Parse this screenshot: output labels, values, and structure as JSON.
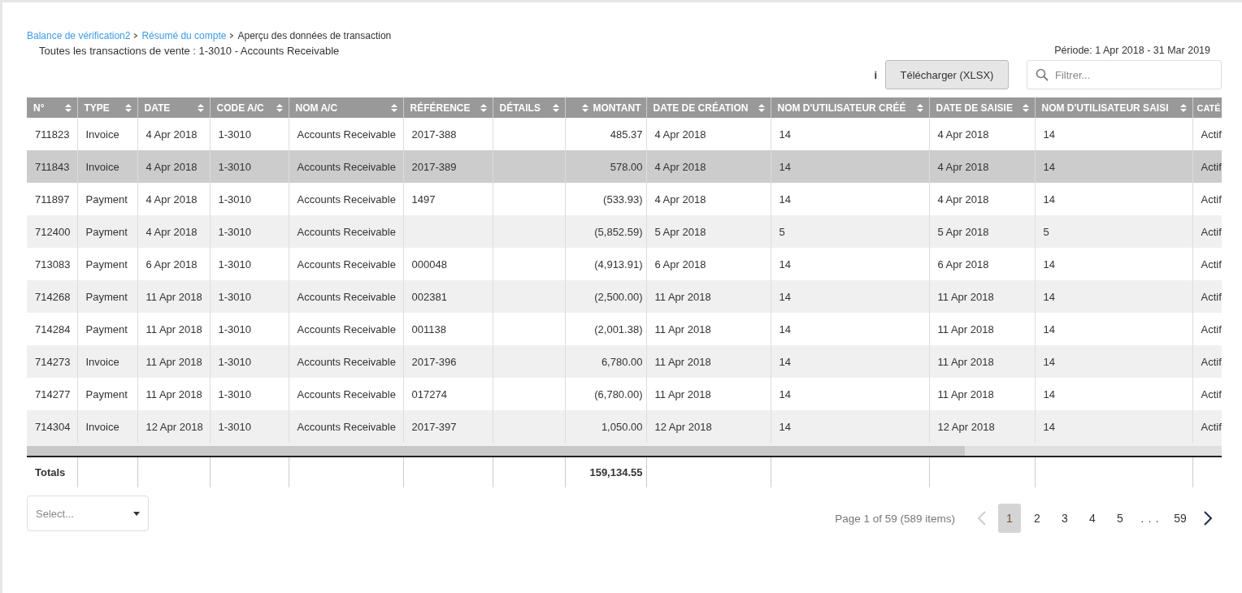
{
  "breadcrumb": [
    {
      "label": "Balance de vérification2",
      "link": true
    },
    {
      "label": "Résumé du compte",
      "link": true
    },
    {
      "label": "Aperçu des données de transaction",
      "link": false
    }
  ],
  "subtitle": "Toutes les transactions de vente : 1-3010 - Accounts Receivable",
  "period": "Période: 1 Apr 2018 - 31 Mar 2019",
  "info_mark": "i",
  "download_button": "Télécharger (XLSX)",
  "filter": {
    "placeholder": "Filtrer..."
  },
  "table": {
    "columns": [
      {
        "label": "N°",
        "sortable": true,
        "kind": "text"
      },
      {
        "label": "TYPE",
        "sortable": true,
        "kind": "text"
      },
      {
        "label": "DATE",
        "sortable": true,
        "kind": "text"
      },
      {
        "label": "CODE A/C",
        "sortable": true,
        "kind": "text"
      },
      {
        "label": "NOM A/C",
        "sortable": true,
        "kind": "text"
      },
      {
        "label": "RÉFÉRENCE",
        "sortable": true,
        "kind": "text"
      },
      {
        "label": "DÉTAILS",
        "sortable": true,
        "kind": "text"
      },
      {
        "label": "MONTANT",
        "sortable": true,
        "kind": "amount"
      },
      {
        "label": "DATE DE CRÉATION",
        "sortable": true,
        "kind": "text"
      },
      {
        "label": "NOM D'UTILISATEUR CRÉÉ",
        "sortable": true,
        "kind": "text"
      },
      {
        "label": "DATE DE SAISIE",
        "sortable": true,
        "kind": "text"
      },
      {
        "label": "NOM D'UTILISATEUR SAISI",
        "sortable": true,
        "kind": "text"
      },
      {
        "label": "CATÉ",
        "kind": "text"
      }
    ],
    "rows": [
      {
        "selected": false,
        "cells": [
          "711823",
          "Invoice",
          "4 Apr 2018",
          "1-3010",
          "Accounts Receivable",
          "2017-388",
          "",
          "485.37",
          "4 Apr 2018",
          "14",
          "4 Apr 2018",
          "14",
          "Actif"
        ]
      },
      {
        "selected": true,
        "cells": [
          "711843",
          "Invoice",
          "4 Apr 2018",
          "1-3010",
          "Accounts Receivable",
          "2017-389",
          "",
          "578.00",
          "4 Apr 2018",
          "14",
          "4 Apr 2018",
          "14",
          "Actif"
        ]
      },
      {
        "selected": false,
        "cells": [
          "711897",
          "Payment",
          "4 Apr 2018",
          "1-3010",
          "Accounts Receivable",
          "1497",
          "",
          "(533.93)",
          "4 Apr 2018",
          "14",
          "4 Apr 2018",
          "14",
          "Actif"
        ]
      },
      {
        "selected": false,
        "cells": [
          "712400",
          "Payment",
          "4 Apr 2018",
          "1-3010",
          "Accounts Receivable",
          "",
          "",
          "(5,852.59)",
          "5 Apr 2018",
          "5",
          "5 Apr 2018",
          "5",
          "Actif"
        ]
      },
      {
        "selected": false,
        "cells": [
          "713083",
          "Payment",
          "6 Apr 2018",
          "1-3010",
          "Accounts Receivable",
          "000048",
          "",
          "(4,913.91)",
          "6 Apr 2018",
          "14",
          "6 Apr 2018",
          "14",
          "Actif"
        ]
      },
      {
        "selected": false,
        "cells": [
          "714268",
          "Payment",
          "11 Apr 2018",
          "1-3010",
          "Accounts Receivable",
          "002381",
          "",
          "(2,500.00)",
          "11 Apr 2018",
          "14",
          "11 Apr 2018",
          "14",
          "Actif"
        ]
      },
      {
        "selected": false,
        "cells": [
          "714284",
          "Payment",
          "11 Apr 2018",
          "1-3010",
          "Accounts Receivable",
          "001138",
          "",
          "(2,001.38)",
          "11 Apr 2018",
          "14",
          "11 Apr 2018",
          "14",
          "Actif"
        ]
      },
      {
        "selected": false,
        "cells": [
          "714273",
          "Invoice",
          "11 Apr 2018",
          "1-3010",
          "Accounts Receivable",
          "2017-396",
          "",
          "6,780.00",
          "11 Apr 2018",
          "14",
          "11 Apr 2018",
          "14",
          "Actif"
        ]
      },
      {
        "selected": false,
        "cells": [
          "714277",
          "Payment",
          "11 Apr 2018",
          "1-3010",
          "Accounts Receivable",
          "017274",
          "",
          "(6,780.00)",
          "11 Apr 2018",
          "14",
          "11 Apr 2018",
          "14",
          "Actif"
        ]
      },
      {
        "selected": false,
        "cells": [
          "714304",
          "Invoice",
          "12 Apr 2018",
          "1-3010",
          "Accounts Receivable",
          "2017-397",
          "",
          "1,050.00",
          "12 Apr 2018",
          "14",
          "12 Apr 2018",
          "14",
          "Actif"
        ]
      }
    ],
    "totals": {
      "label": "Totals",
      "amount": "159,134.55"
    }
  },
  "page_size_select": {
    "placeholder": "Select..."
  },
  "pagination": {
    "summary": "Page 1 of 59 (589 items)",
    "prev_disabled": true,
    "next_disabled": false,
    "pages": [
      {
        "label": "1",
        "selected": true,
        "kind": "page"
      },
      {
        "label": "2",
        "selected": false,
        "kind": "page"
      },
      {
        "label": "3",
        "selected": false,
        "kind": "page"
      },
      {
        "label": "4",
        "selected": false,
        "kind": "page"
      },
      {
        "label": "5",
        "selected": false,
        "kind": "page"
      },
      {
        "label": ". . .",
        "kind": "ellipsis"
      },
      {
        "label": "59",
        "selected": false,
        "kind": "page"
      }
    ]
  }
}
